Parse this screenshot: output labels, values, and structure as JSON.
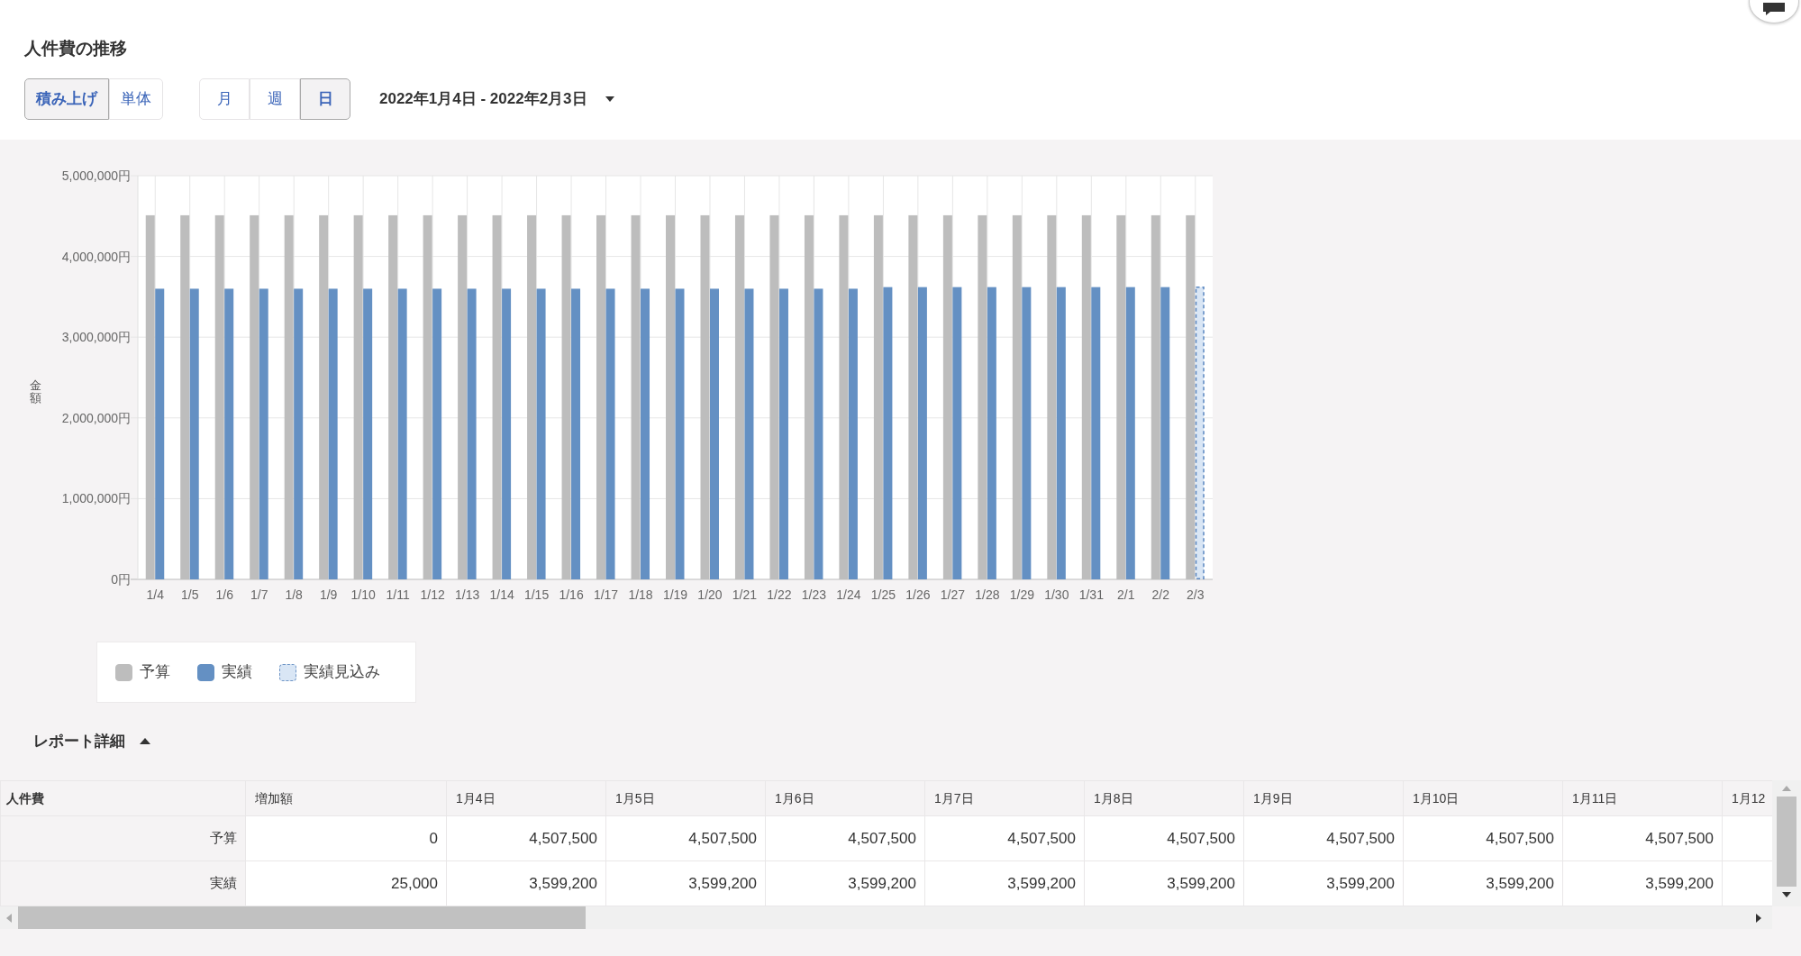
{
  "title": "人件費の推移",
  "display_modes": [
    {
      "label": "積み上げ",
      "selected": true
    },
    {
      "label": "単体",
      "selected": false
    }
  ],
  "periods": [
    {
      "label": "月",
      "selected": false
    },
    {
      "label": "週",
      "selected": false
    },
    {
      "label": "日",
      "selected": true
    }
  ],
  "date_range": "2022年1月4日 - 2022年2月3日",
  "chart": {
    "chart_data": {
      "type": "bar",
      "ylabel": "金額",
      "ylim": [
        0,
        5000000
      ],
      "grid": true,
      "yticks": [
        {
          "value": 0,
          "label": "0円"
        },
        {
          "value": 1000000,
          "label": "1,000,000円"
        },
        {
          "value": 2000000,
          "label": "2,000,000円"
        },
        {
          "value": 3000000,
          "label": "3,000,000円"
        },
        {
          "value": 4000000,
          "label": "4,000,000円"
        },
        {
          "value": 5000000,
          "label": "5,000,000円"
        }
      ],
      "categories": [
        "1/4",
        "1/5",
        "1/6",
        "1/7",
        "1/8",
        "1/9",
        "1/10",
        "1/11",
        "1/12",
        "1/13",
        "1/14",
        "1/15",
        "1/16",
        "1/17",
        "1/18",
        "1/19",
        "1/20",
        "1/21",
        "1/22",
        "1/23",
        "1/24",
        "1/25",
        "1/26",
        "1/27",
        "1/28",
        "1/29",
        "1/30",
        "1/31",
        "2/1",
        "2/2",
        "2/3"
      ],
      "series": [
        {
          "name": "予算",
          "color": "#bdbdbd",
          "values": [
            4510000,
            4510000,
            4510000,
            4510000,
            4510000,
            4510000,
            4510000,
            4510000,
            4510000,
            4510000,
            4510000,
            4510000,
            4510000,
            4510000,
            4510000,
            4510000,
            4510000,
            4510000,
            4510000,
            4510000,
            4510000,
            4510000,
            4510000,
            4510000,
            4510000,
            4510000,
            4510000,
            4510000,
            4510000,
            4510000,
            4510000
          ]
        },
        {
          "name": "実績",
          "color": "#6490c3",
          "values": [
            3600000,
            3600000,
            3600000,
            3600000,
            3600000,
            3600000,
            3600000,
            3600000,
            3600000,
            3600000,
            3600000,
            3600000,
            3600000,
            3600000,
            3600000,
            3600000,
            3600000,
            3600000,
            3600000,
            3600000,
            3600000,
            3620000,
            3620000,
            3620000,
            3620000,
            3620000,
            3620000,
            3620000,
            3620000,
            3620000,
            null
          ]
        },
        {
          "name": "実績見込み",
          "color": "#d9e6f5",
          "values": [
            null,
            null,
            null,
            null,
            null,
            null,
            null,
            null,
            null,
            null,
            null,
            null,
            null,
            null,
            null,
            null,
            null,
            null,
            null,
            null,
            null,
            null,
            null,
            null,
            null,
            null,
            null,
            null,
            null,
            null,
            3620000
          ]
        }
      ]
    },
    "series_styles": [
      {
        "kind": "solid"
      },
      {
        "kind": "solid"
      },
      {
        "kind": "dashed"
      }
    ]
  },
  "report_details": {
    "title": "レポート詳細",
    "expanded": true
  },
  "table": {
    "columns": [
      "人件費",
      "増加額",
      "1月4日",
      "1月5日",
      "1月6日",
      "1月7日",
      "1月8日",
      "1月9日",
      "1月10日",
      "1月11日",
      "1月12"
    ],
    "rows": [
      {
        "cells": [
          "予算",
          "0",
          "4,507,500",
          "4,507,500",
          "4,507,500",
          "4,507,500",
          "4,507,500",
          "4,507,500",
          "4,507,500",
          "4,507,500",
          ""
        ]
      },
      {
        "cells": [
          "実績",
          "25,000",
          "3,599,200",
          "3,599,200",
          "3,599,200",
          "3,599,200",
          "3,599,200",
          "3,599,200",
          "3,599,200",
          "3,599,200",
          ""
        ]
      }
    ]
  }
}
